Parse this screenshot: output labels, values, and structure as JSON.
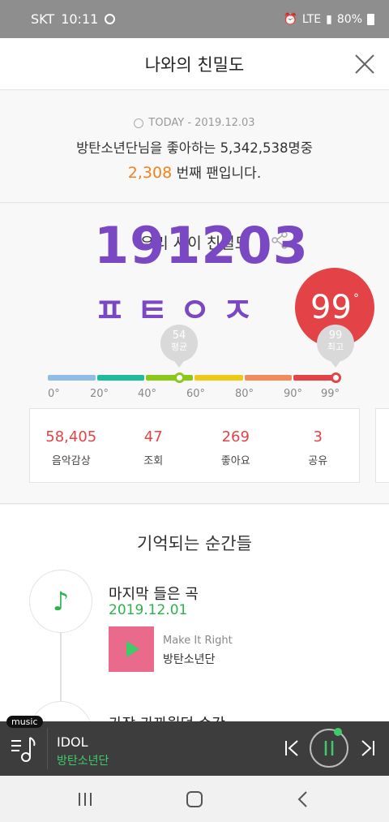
{
  "status_bar": {
    "carrier": "SKT",
    "time": "10:11",
    "network": "LTE",
    "battery": "80%"
  },
  "header": {
    "title": "나와의 친밀도"
  },
  "today": {
    "date": "TODAY - 2019.12.03",
    "line1": "방탄소년단님을 좋아하는 5,342,538명중",
    "rank": "2,308",
    "line2_suffix": " 번째 팬입니다."
  },
  "closeness": {
    "title": "우리 사이 친밀도",
    "score": "99",
    "score_unit": "°",
    "average_value": "54",
    "average_label": "평균",
    "max_value": "99",
    "max_label": "최고",
    "average_level": 54,
    "current_level": 99,
    "gauge_colors": [
      "#8fbde8",
      "#1fbc9b",
      "#8ac81a",
      "#f0c916",
      "#f28a5b",
      "#e34346"
    ],
    "ticks": [
      "0°",
      "20°",
      "40°",
      "60°",
      "80°",
      "90°",
      "99°"
    ],
    "stats": [
      {
        "value": "58,405",
        "label": "음악감상"
      },
      {
        "value": "47",
        "label": "조회"
      },
      {
        "value": "269",
        "label": "좋아요"
      },
      {
        "value": "3",
        "label": "공유"
      }
    ]
  },
  "overlay": {
    "date": "191203",
    "sub": "ㅍㅌㅇㅈ"
  },
  "memories": {
    "title": "기억되는 순간들",
    "items": [
      {
        "title": "마지막 들은 곡",
        "date": "2019.12.01",
        "song": "Make It Right",
        "artist": "방탄소년단"
      },
      {
        "title": "가장 가까웠던 순간"
      }
    ]
  },
  "player": {
    "tag": "music",
    "track": "IDOL",
    "artist": "방탄소년단"
  },
  "colors": {
    "accent_green": "#3ecb6a",
    "score_red": "#e34346",
    "rank_orange": "#f0821e",
    "overlay_purple": "#7b48c4"
  }
}
